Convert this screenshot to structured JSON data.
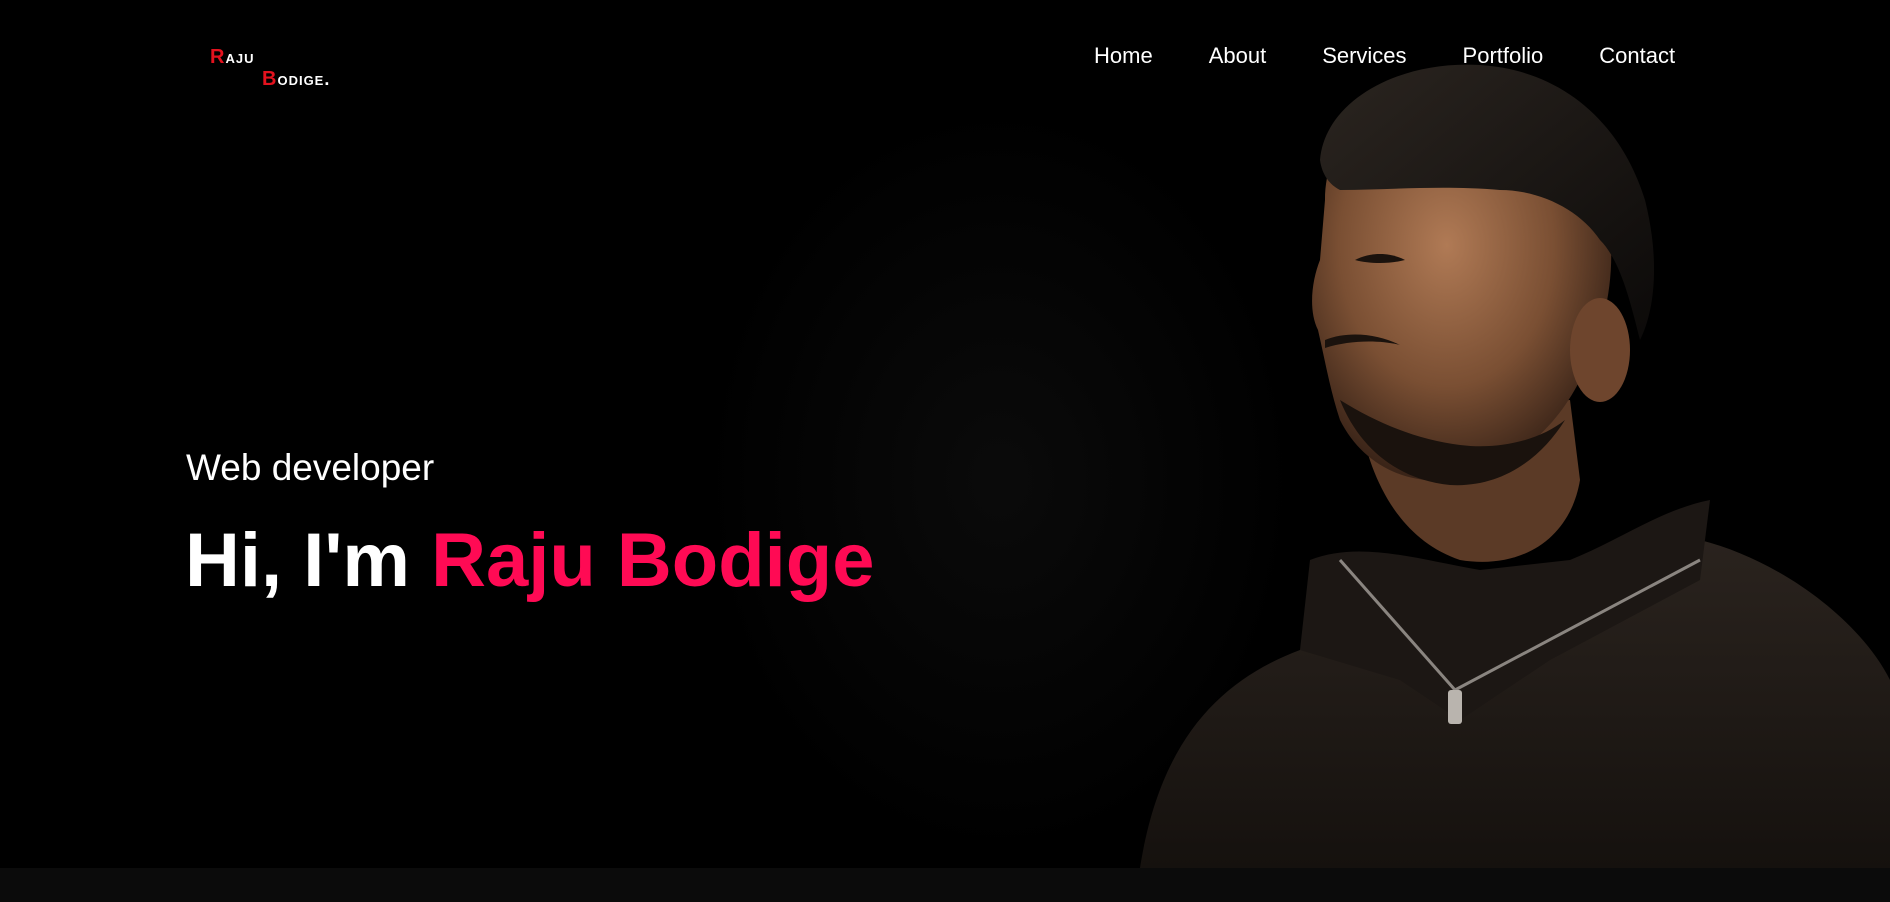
{
  "logo": {
    "line1_cap": "R",
    "line1_rest": "aju",
    "line2_cap": "B",
    "line2_rest": "odige."
  },
  "nav": {
    "items": [
      {
        "label": "Home"
      },
      {
        "label": "About"
      },
      {
        "label": "Services"
      },
      {
        "label": "Portfolio"
      },
      {
        "label": "Contact"
      }
    ]
  },
  "hero": {
    "subtitle": "Web developer",
    "greeting": "Hi, I'm ",
    "name": "Raju Bodige",
    "accent_color": "#ff0a54",
    "background_color": "#000000"
  },
  "portrait": {
    "description_icon": "person-portrait"
  }
}
